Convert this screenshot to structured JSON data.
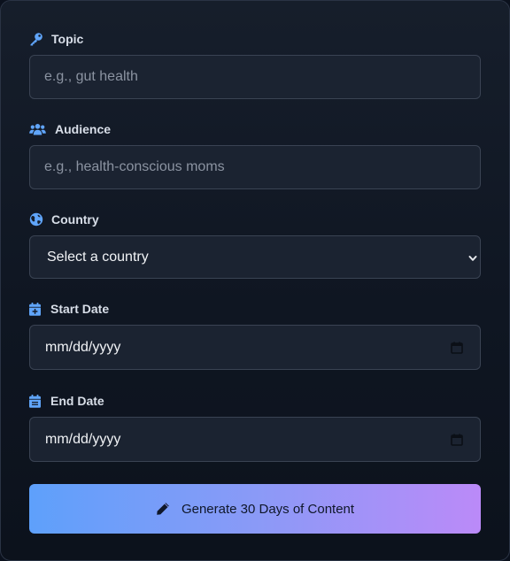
{
  "form": {
    "topic": {
      "label": "Topic",
      "placeholder": "e.g., gut health",
      "value": ""
    },
    "audience": {
      "label": "Audience",
      "placeholder": "e.g., health-conscious moms",
      "value": ""
    },
    "country": {
      "label": "Country",
      "selected": "Select a country"
    },
    "start_date": {
      "label": "Start Date",
      "display": "mm/dd/yyyy"
    },
    "end_date": {
      "label": "End Date",
      "display": "mm/dd/yyyy"
    },
    "submit_label": "Generate 30 Days of Content"
  },
  "icons": {
    "topic": "key-icon",
    "audience": "users-icon",
    "country": "globe-icon",
    "start_date": "calendar-plus-icon",
    "end_date": "calendar-icon",
    "submit": "pencil-icon",
    "select": "chevron-down-icon",
    "date_picker": "calendar-outline-icon"
  },
  "colors": {
    "accent_icon": "#60a5fa",
    "button_gradient_start": "#5ea0fb",
    "button_gradient_end": "#bb8af8"
  }
}
